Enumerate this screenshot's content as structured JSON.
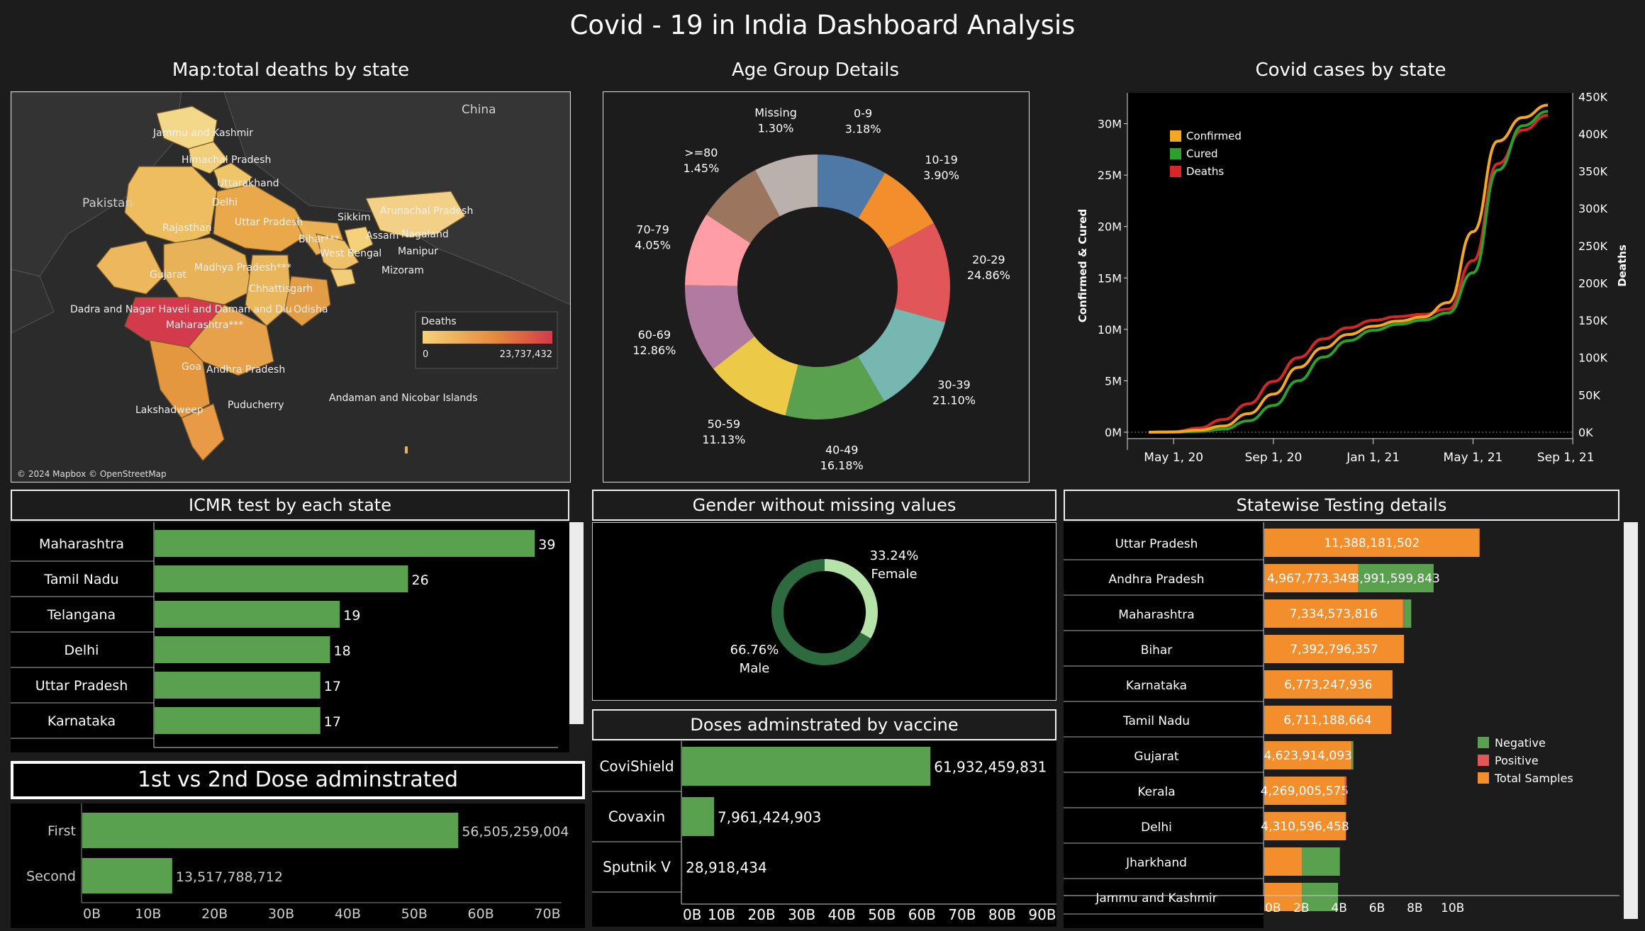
{
  "dashboard_title": "Covid - 19 in India Dashboard Analysis",
  "map": {
    "title": "Map:total deaths by state",
    "labels": [
      "Jammu and Kashmir",
      "Himachal Pradesh",
      "Uttarakhand",
      "Delhi",
      "Rajasthan",
      "Uttar Pradesh",
      "Sikkim",
      "Arunachal Pradesh",
      "Assam",
      "Nagaland",
      "Bihar***",
      "West Bengal",
      "Manipur",
      "Mizoram",
      "Gujarat",
      "Madhya Pradesh***",
      "Chhattisgarh",
      "Dadra and Nagar Haveli and Daman and Diu",
      "Odisha",
      "Maharashtra***",
      "Goa",
      "Andhra Pradesh",
      "Puducherry",
      "Lakshadweep",
      "Andaman and Nicobar Islands",
      "Pakistan",
      "China"
    ],
    "legend_title": "Deaths",
    "legend_min": "0",
    "legend_max": "23,737,432",
    "attribution": "© 2024 Mapbox © OpenStreetMap",
    "colors": {
      "low": "#f5d27a",
      "mid": "#e58c3c",
      "high": "#d33a4b",
      "background": "#2a2a2a"
    }
  },
  "age": {
    "title": "Age Group Details",
    "chart_data": {
      "type": "pie",
      "categories": [
        "0-9",
        "10-19",
        "20-29",
        "30-39",
        "40-49",
        "50-59",
        "60-69",
        "70-79",
        ">=80",
        "Missing"
      ],
      "values": [
        3.18,
        3.9,
        24.86,
        21.1,
        16.18,
        11.13,
        12.86,
        4.05,
        1.45,
        1.3
      ],
      "value_labels": [
        "3.18%",
        "3.90%",
        "24.86%",
        "21.10%",
        "16.18%",
        "11.13%",
        "12.86%",
        "4.05%",
        "1.45%",
        "1.30%"
      ],
      "colors": [
        "#4e79a7",
        "#f28e2b",
        "#e15759",
        "#76b7b2",
        "#59a14f",
        "#edc948",
        "#b07aa1",
        "#ff9da7",
        "#9c755f",
        "#bab0ac"
      ]
    }
  },
  "cases": {
    "title": "Covid cases by state",
    "chart_data": {
      "type": "line",
      "x": [
        "Apr 1, 20",
        "May 1, 20",
        "Jun 1, 20",
        "Jul 1, 20",
        "Aug 1, 20",
        "Sep 1, 20",
        "Oct 1, 20",
        "Nov 1, 20",
        "Dec 1, 20",
        "Jan 1, 21",
        "Feb 1, 21",
        "Mar 1, 21",
        "Apr 1, 21",
        "May 1, 21",
        "Jun 1, 21",
        "Jul 1, 21",
        "Aug 1, 21"
      ],
      "x_ticks": [
        "May 1, 20",
        "Sep 1, 20",
        "Jan 1, 21",
        "May 1, 21",
        "Sep 1, 21"
      ],
      "ylabel": "Confirmed & Cured",
      "ylabel_right": "Deaths",
      "y_ticks": [
        "0M",
        "5M",
        "10M",
        "15M",
        "20M",
        "25M",
        "30M"
      ],
      "y_right_ticks": [
        "0K",
        "50K",
        "100K",
        "150K",
        "200K",
        "250K",
        "300K",
        "350K",
        "400K",
        "450K"
      ],
      "ylim": [
        0,
        33000000
      ],
      "ylim_right": [
        0,
        455000
      ],
      "series": [
        {
          "name": "Confirmed",
          "axis": "left",
          "color": "#f5a623",
          "values": [
            0,
            0.03,
            0.2,
            0.6,
            1.8,
            3.7,
            6.3,
            8.2,
            9.5,
            10.3,
            10.8,
            11.2,
            12.6,
            19.5,
            28.3,
            30.6,
            31.8
          ]
        },
        {
          "name": "Cured",
          "axis": "left",
          "color": "#2ca02c",
          "values": [
            0,
            0.01,
            0.08,
            0.3,
            1.1,
            2.6,
            5.0,
            7.3,
            8.9,
            9.9,
            10.5,
            10.9,
            11.6,
            15.5,
            25.5,
            29.8,
            31.2
          ]
        },
        {
          "name": "Deaths",
          "axis": "right",
          "color": "#d62728",
          "values": [
            0,
            0.5,
            5.5,
            17,
            38,
            68,
            100,
            125,
            140,
            150,
            155,
            158,
            165,
            230,
            360,
            405,
            425
          ]
        }
      ],
      "deaths_unit": "K"
    }
  },
  "icmr": {
    "title": "ICMR test by each state",
    "chart_data": {
      "type": "bar",
      "categories": [
        "Maharashtra",
        "Tamil Nadu",
        "Telangana",
        "Delhi",
        "Uttar Pradesh",
        "Karnataka"
      ],
      "values": [
        39,
        26,
        19,
        18,
        17,
        17
      ],
      "ticks": [
        "0",
        "5",
        "10",
        "15",
        "20",
        "25",
        "30",
        "35",
        "40"
      ],
      "xlim": [
        0,
        40
      ],
      "color": "#59a14f"
    }
  },
  "gender": {
    "title": "Gender without missing values",
    "chart_data": {
      "type": "pie",
      "categories": [
        "Female",
        "Male"
      ],
      "values": [
        33.24,
        66.76
      ],
      "value_labels": [
        "33.24%",
        "66.76%"
      ],
      "colors": [
        "#b6e3a8",
        "#2d6a3e"
      ]
    }
  },
  "doses_vaccine": {
    "title": "Doses adminstrated by vaccine",
    "chart_data": {
      "type": "bar",
      "categories": [
        "CoviShield",
        "Covaxin",
        "Sputnik V"
      ],
      "values": [
        61932459831,
        7961424903,
        28918434
      ],
      "value_labels": [
        "61,932,459,831",
        "7,961,424,903",
        "28,918,434"
      ],
      "ticks": [
        "0B",
        "10B",
        "20B",
        "30B",
        "40B",
        "50B",
        "60B",
        "70B",
        "80B",
        "90B"
      ],
      "xlim": [
        0,
        90000000000
      ],
      "color": "#59a14f"
    }
  },
  "first_second": {
    "title": "1st vs 2nd Dose adminstrated",
    "chart_data": {
      "type": "bar",
      "categories": [
        "First",
        "Second"
      ],
      "values": [
        56505259004,
        13517788712
      ],
      "value_labels": [
        "56,505,259,004",
        "13,517,788,712"
      ],
      "ticks": [
        "0B",
        "10B",
        "20B",
        "30B",
        "40B",
        "50B",
        "60B",
        "70B"
      ],
      "xlim": [
        0,
        70000000000
      ],
      "color": "#59a14f"
    }
  },
  "statewise": {
    "title": "Statewise Testing details",
    "chart_data": {
      "type": "bar",
      "categories": [
        "Uttar Pradesh",
        "Andhra Pradesh",
        "Maharashtra",
        "Bihar",
        "Karnataka",
        "Tamil Nadu",
        "Gujarat",
        "Kerala",
        "Delhi",
        "Jharkhand",
        "Jammu and Kashmir"
      ],
      "series": [
        {
          "name": "Total Samples",
          "color": "#f28e2b",
          "values": [
            11388181502,
            4967773349,
            7334573816,
            7392796357,
            6773247936,
            6711188664,
            4623914093,
            4269005575,
            4310596458,
            2000000000,
            2000000000
          ]
        },
        {
          "name": "Positive",
          "color": "#e15759",
          "values": [
            0,
            0,
            60000000,
            0,
            20000000,
            20000000,
            10000000,
            80000000,
            20000000,
            0,
            0
          ]
        },
        {
          "name": "Negative",
          "color": "#59a14f",
          "values": [
            0,
            3991599843,
            380000000,
            0,
            0,
            0,
            80000000,
            0,
            0,
            2000000000,
            1900000000
          ]
        }
      ],
      "value_labels": [
        "11,388,181,502",
        "4,967,773,349",
        "7,334,573,816",
        "7,392,796,357",
        "6,773,247,936",
        "6,711,188,664",
        "4,623,914,093",
        "4,269,005,575",
        "4,310,596,458",
        "",
        ""
      ],
      "negative_labels": [
        "",
        "3,991,599,843",
        "",
        "",
        "",
        "",
        "",
        "",
        "",
        "",
        ""
      ],
      "legend": [
        "Negative",
        "Positive",
        "Total Samples"
      ],
      "ticks": [
        "0B",
        "2B",
        "4B",
        "6B",
        "8B",
        "10B"
      ],
      "xlim": [
        0,
        12000000000
      ]
    }
  }
}
